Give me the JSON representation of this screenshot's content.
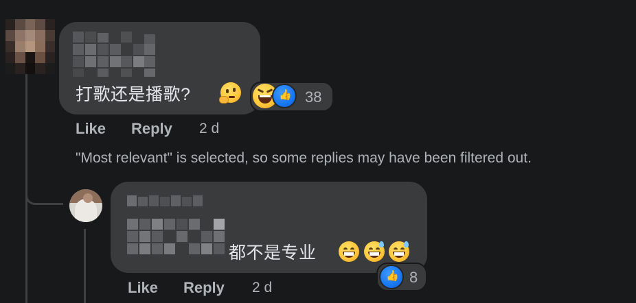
{
  "comment": {
    "text": "打歌还是播歌?",
    "reactions_count": "38",
    "actions": {
      "like": "Like",
      "reply": "Reply",
      "time": "2 d"
    }
  },
  "filter_notice": "\"Most relevant\" is selected, so some replies may have been filtered out.",
  "reply": {
    "text": "都不是专业",
    "reactions_count": "8",
    "actions": {
      "like": "Like",
      "reply": "Reply",
      "time": "2 d"
    }
  },
  "icons": {
    "reaction_like": "thumbs-up-icon",
    "reaction_haha": "laughing-emoji",
    "thinking": "thinking-face-emoji",
    "grin": "grinning-emoji",
    "sweat_smile": "sweat-smile-emoji"
  },
  "colors": {
    "background": "#18191a",
    "bubble": "#3a3b3c",
    "secondary_text": "#b0b3b8",
    "like_blue": "#1877f2"
  }
}
